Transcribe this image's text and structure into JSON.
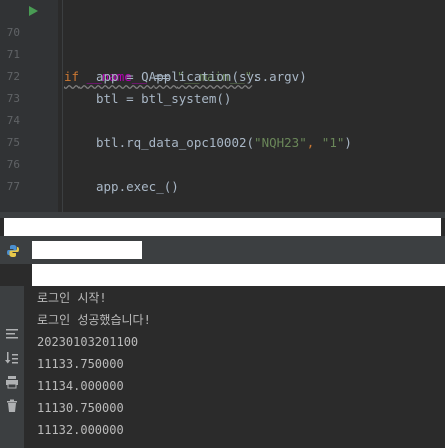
{
  "editor": {
    "lines": [
      {
        "num": "70",
        "kw": "if",
        "a": " __name__ ",
        "b": "== ",
        "s": "\"__main__\"",
        "c": ":"
      },
      {
        "num": "71",
        "text": "app = QApplication(sys.argv)"
      },
      {
        "num": "72",
        "text": "btl = btl_system()"
      },
      {
        "num": "73",
        "text": ""
      },
      {
        "num": "74",
        "pre": "btl.rq_data_opc10002(",
        "s1": "\"NQH23\"",
        "mid": ", ",
        "s2": "\"1\"",
        "post": ")"
      },
      {
        "num": "75",
        "text": ""
      },
      {
        "num": "76",
        "text": "app.exec_()"
      },
      {
        "num": "77",
        "text": ""
      }
    ]
  },
  "console": {
    "output": [
      "로그인 시작!",
      "로그인 성공했습니다!",
      "20230103201100",
      "11133.750000",
      "11134.000000",
      "11130.750000",
      "11132.000000"
    ]
  },
  "icons": {
    "run": "run-gutter-icon",
    "python": "python-icon",
    "wrap": "soft-wrap-icon",
    "scroll_end": "scroll-to-end-icon",
    "print": "print-icon",
    "trash": "trash-icon"
  },
  "colors": {
    "background": "#2b2b2b",
    "keyword": "#cc7832",
    "string": "#6a8759",
    "dunder": "#b200b2",
    "identifier": "#a9b7c6",
    "console_text": "#bbbbbb"
  }
}
